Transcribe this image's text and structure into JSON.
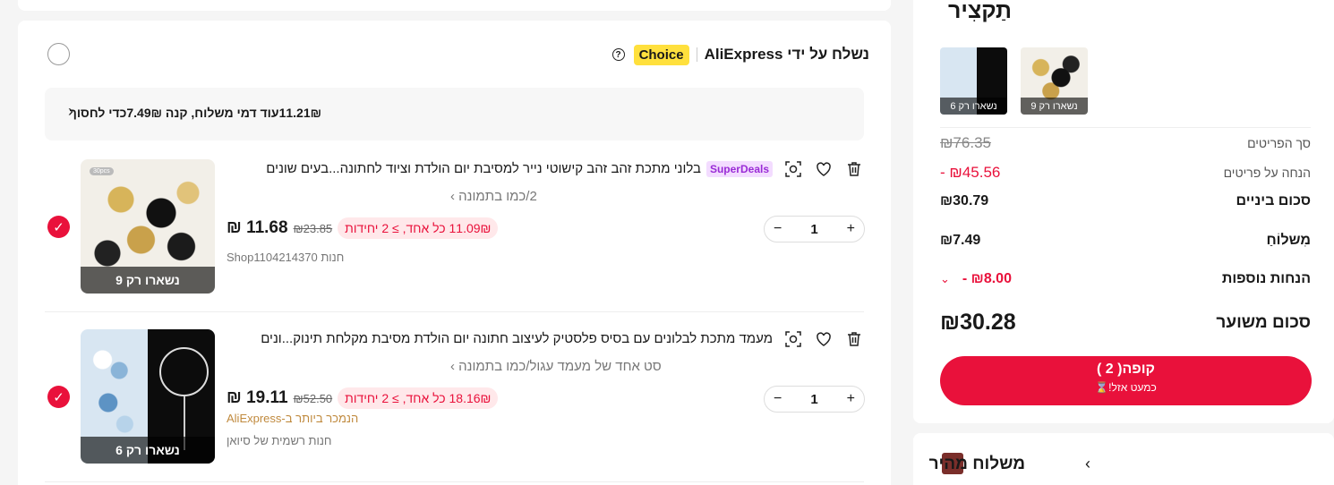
{
  "store": {
    "shipped_by_label": "נשלח על ידי",
    "brand": "AliExpress",
    "choice_badge": "Choice",
    "help_glyph": "?"
  },
  "shipping_banner": {
    "text": "11.21₪עוד  דמי משלוח, קנה 7.49₪כדי לחסוך"
  },
  "items": [
    {
      "title": "בלוני מתכת זהב זהב קישוטי נייר למסיבת יום הולדת וציוד לחתונה...בעים שונים",
      "badge": "SuperDeals",
      "variant": "2/כמו בתמונה",
      "price": "₪ 11.68",
      "old_price": "₪23.85",
      "promo": "11.09₪ כל אחד, ≥ 2 יחידות",
      "shop": "חנות Shop1104214370",
      "stock": "נשארו רק 9",
      "quantity": "1",
      "thumb_tag": "30pcs"
    },
    {
      "title": "מעמד מתכת לבלונים עם בסיס פלסטיק לעיצוב חתונה יום הולדת מסיבת מקלחת תינוק...ונים",
      "variant": "סט אחד של מעמד עגול/כמו בתמונה",
      "price": "₪ 19.11",
      "old_price": "₪52.50",
      "promo": "18.16₪ כל אחד, ≥ 2 יחידות",
      "best_seller": "הנמכר ביותר ב-AliExpress",
      "shop": "חנות רשמית של סיואן",
      "stock": "נשארו רק 6",
      "quantity": "1"
    }
  ],
  "summary": {
    "title": "תַקצִיר",
    "thumb_stock": [
      "נשארו רק 6",
      "נשארו רק 9"
    ],
    "items_total_label": "סך הפריטים",
    "items_total_value": "₪76.35",
    "items_discount_label": "הנחה על פריטים",
    "items_discount_value": "- ₪45.56",
    "subtotal_label": "סכום ביניים",
    "subtotal_value": "₪30.79",
    "shipping_label": "מִשלוֹחַ",
    "shipping_value": "₪7.49",
    "extra_discounts_label": "הנחות נוספות",
    "extra_discounts_value": "- ₪8.00",
    "estimated_total_label": "סכום משוער",
    "estimated_total_value": "₪30.28",
    "checkout_label": "קופה( 2 )",
    "checkout_sub": "כמעט אזל!⌛"
  },
  "fast_shipping": {
    "label": "משלוח מהיר"
  },
  "colors": {
    "accent": "#e9113b",
    "choice": "#ffe03d",
    "superdeals_bg": "#f3dcff",
    "superdeals_text": "#9a2bd6"
  }
}
